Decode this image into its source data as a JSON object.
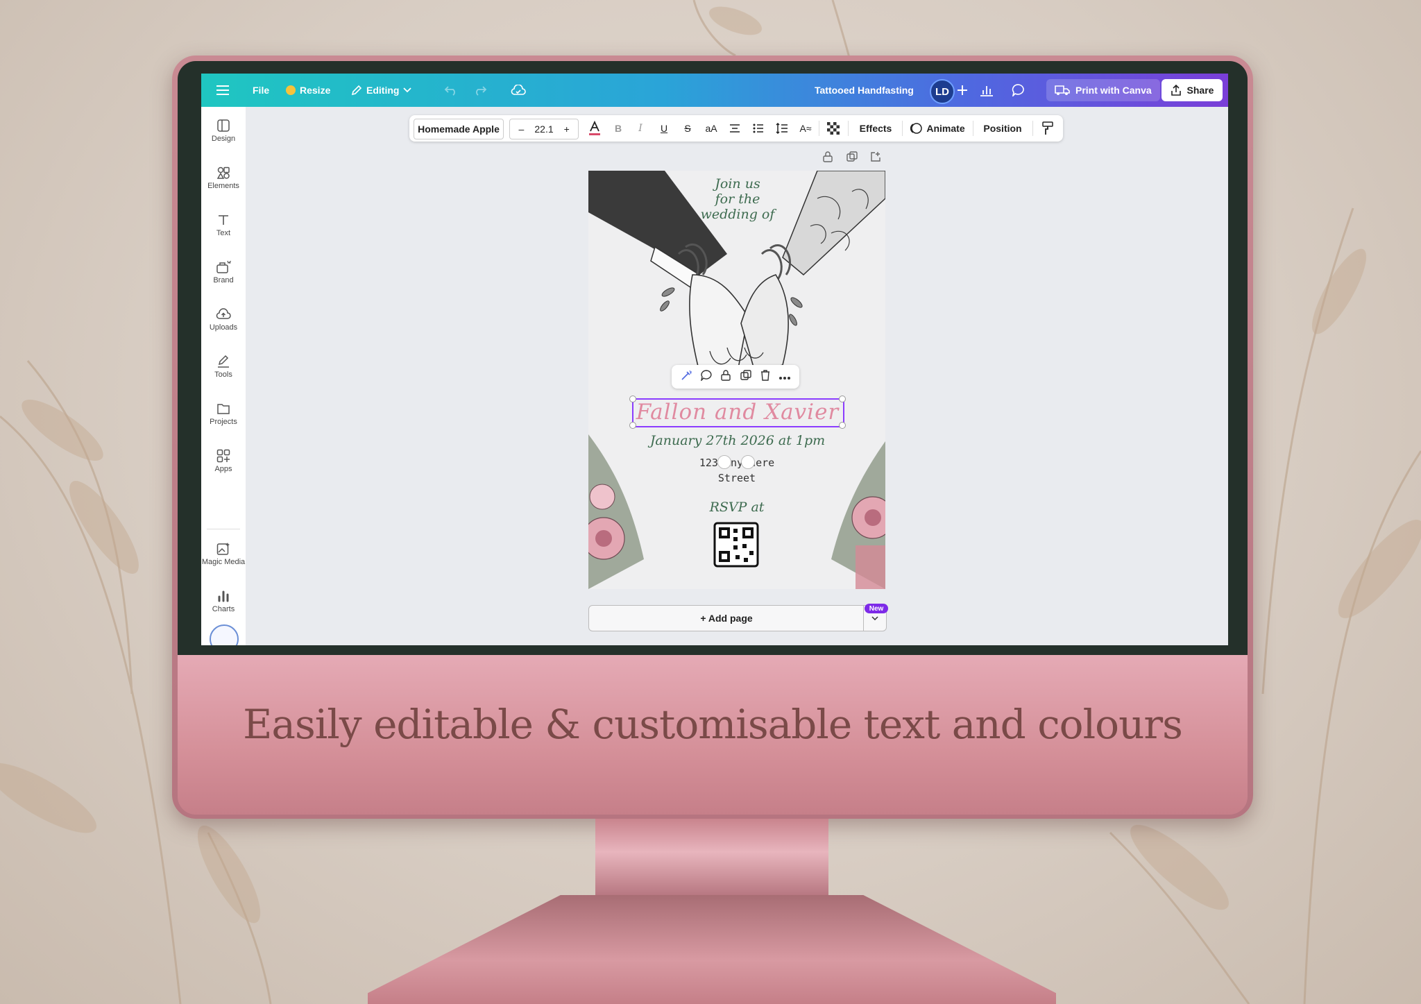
{
  "tagline": "Easily editable & customisable text and colours",
  "topbar": {
    "file": "File",
    "resize": "Resize",
    "editing": "Editing",
    "doc_title": "Tattooed Handfasting",
    "avatar_initials": "LD",
    "print": "Print with Canva",
    "share": "Share"
  },
  "sidebar": {
    "items": [
      {
        "label": "Design",
        "icon": "layout-icon"
      },
      {
        "label": "Elements",
        "icon": "shapes-icon"
      },
      {
        "label": "Text",
        "icon": "text-icon"
      },
      {
        "label": "Brand",
        "icon": "brand-icon"
      },
      {
        "label": "Uploads",
        "icon": "cloud-upload-icon"
      },
      {
        "label": "Tools",
        "icon": "pen-tool-icon"
      },
      {
        "label": "Projects",
        "icon": "folder-icon"
      },
      {
        "label": "Apps",
        "icon": "apps-icon"
      },
      {
        "label": "Magic Media",
        "icon": "magic-image-icon"
      },
      {
        "label": "Charts",
        "icon": "bar-chart-icon"
      }
    ]
  },
  "format_toolbar": {
    "font": "Homemade Apple",
    "size": "22.1",
    "minus": "–",
    "plus": "+",
    "effects": "Effects",
    "animate": "Animate",
    "position": "Position",
    "text_color": "#d94b6a"
  },
  "invitation": {
    "intro_line1": "Join us",
    "intro_line2": "for the",
    "intro_line3": "wedding of",
    "names": "Fallon and Xavier",
    "date": "January 27th 2026 at 1pm",
    "address_line1": "123 Anywhere",
    "address_line2": "Street",
    "rsvp": "RSVP at"
  },
  "add_page": "+ Add page",
  "new_badge": "New",
  "colors": {
    "accent": "#7d2ae8",
    "script_green": "#3d6b4f",
    "names_pink": "#e08aa0"
  }
}
